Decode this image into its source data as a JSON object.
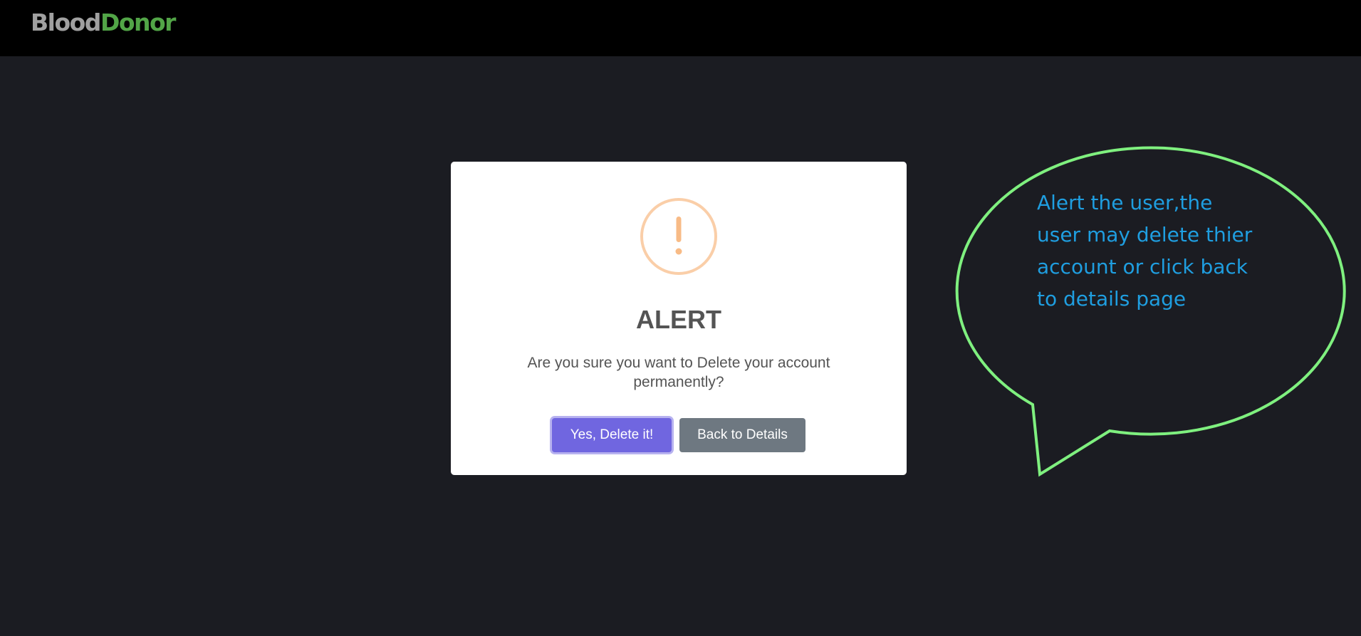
{
  "navbar": {
    "brand_part1": "Blood",
    "brand_part2": "Donor",
    "brand_color1": "#a0a0a0",
    "brand_color2": "#52a547"
  },
  "dialog": {
    "icon": "warning-exclamation-icon",
    "icon_color": "#f8bb86",
    "title": "ALERT",
    "message": "Are you sure you want to Delete your account permanently?",
    "confirm_label": "Yes, Delete it!",
    "cancel_label": "Back to Details",
    "confirm_color": "#7066e0",
    "cancel_color": "#6e7881"
  },
  "annotation": {
    "text_line1": "Alert the user,the",
    "text_line2": "user may delete thier",
    "text_line3": "account or click back",
    "text_line4": "to details page",
    "outline_color": "#7ff07f",
    "text_color": "#1f9ee0"
  }
}
